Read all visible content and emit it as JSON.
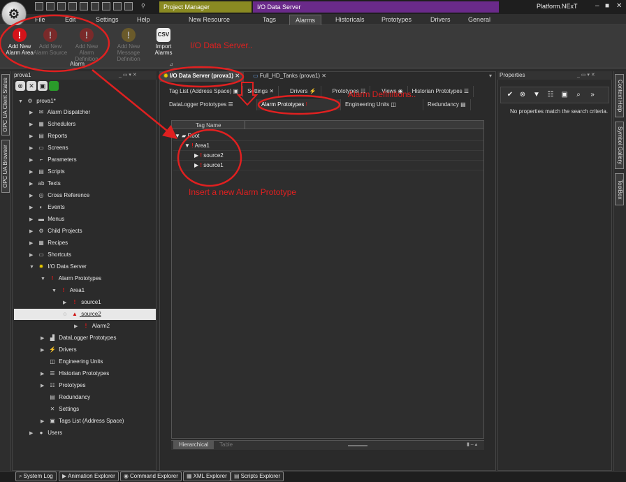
{
  "titlebar": {
    "tab_project_manager": "Project Manager",
    "tab_io_data_server": "I/O Data Server",
    "app_title": "Platform.NExT",
    "min": "–",
    "restore": "■",
    "close": "✕"
  },
  "menu": {
    "file": "File",
    "edit": "Edit",
    "settings": "Settings",
    "help": "Help"
  },
  "ribbon_tabs": {
    "new_resource": "New Resource",
    "tags": "Tags",
    "alarms": "Alarms",
    "historicals": "Historicals",
    "prototypes": "Prototypes",
    "drivers": "Drivers",
    "general": "General"
  },
  "ribbon": {
    "add_new_alarm_area": "Add New Alarm Area",
    "add_new_alarm_source": "Add New Alarm Source",
    "add_new_alarm_definition": "Add New Alarm Definition",
    "add_new_message_definition": "Add New Message Definition",
    "import_alarms": "Import Alarms",
    "csv": "CSV",
    "group_label": "Alarm"
  },
  "annotations": {
    "io_data_server": "I/O Data Server..",
    "alarm_definitions": "Alarm Definitions..",
    "insert_prototype": "Insert a new Alarm Prototype"
  },
  "left_strip": {
    "tab1": "OPC UA Client Status",
    "tab2": "OPC UA Browser"
  },
  "right_strip": {
    "tab1": "Context Help",
    "tab2": "Symbol Gallery",
    "tab3": "ToolBox"
  },
  "tree": {
    "header": "prova1",
    "items": [
      {
        "label": "prova1*"
      },
      {
        "label": "Alarm Dispatcher"
      },
      {
        "label": "Schedulers"
      },
      {
        "label": "Reports"
      },
      {
        "label": "Screens"
      },
      {
        "label": "Parameters"
      },
      {
        "label": "Scripts"
      },
      {
        "label": "Texts"
      },
      {
        "label": "Cross Reference"
      },
      {
        "label": "Events"
      },
      {
        "label": "Menus"
      },
      {
        "label": "Child Projects"
      },
      {
        "label": "Recipes"
      },
      {
        "label": "Shortcuts"
      },
      {
        "label": "I/O Data Server"
      },
      {
        "label": "Alarm Prototypes"
      },
      {
        "label": "Area1"
      },
      {
        "label": "source1"
      },
      {
        "label": "source2"
      },
      {
        "label": "Alarm2"
      },
      {
        "label": "DataLogger Prototypes"
      },
      {
        "label": "Drivers"
      },
      {
        "label": "Engineering Units"
      },
      {
        "label": "Historian Prototypes"
      },
      {
        "label": "Prototypes"
      },
      {
        "label": "Redundancy"
      },
      {
        "label": "Settings"
      },
      {
        "label": "Tags List (Address Space)"
      },
      {
        "label": "Users"
      }
    ]
  },
  "center": {
    "doc_tab_1": "I/O Data Server (prova1)",
    "doc_tab_2": "Full_HD_Tanks (prova1)",
    "subtabs_row1": [
      "Tag List (Address Space)",
      "Settings",
      "Drivers",
      "Prototypes",
      "Views",
      "Historian Prototypes"
    ],
    "subtabs_row2": [
      "DataLogger Prototypes",
      "Alarm Prototypes",
      "Engineering Units",
      "Redundancy"
    ],
    "grid_header": "Tag Name",
    "grid_rows": [
      {
        "label": "Root"
      },
      {
        "label": "Area1"
      },
      {
        "label": "source2"
      },
      {
        "label": "source1"
      }
    ],
    "bottom_tab_hierarchical": "Hierarchical",
    "bottom_tab_table": "Table"
  },
  "properties": {
    "header": "Properties",
    "empty_message": "No properties match the search criteria."
  },
  "statusbar": {
    "system_log": "System Log",
    "animation_explorer": "Animation Explorer",
    "command_explorer": "Command Explorer",
    "xml_explorer": "XML Explorer",
    "scripts_explorer": "Scripts Explorer"
  }
}
